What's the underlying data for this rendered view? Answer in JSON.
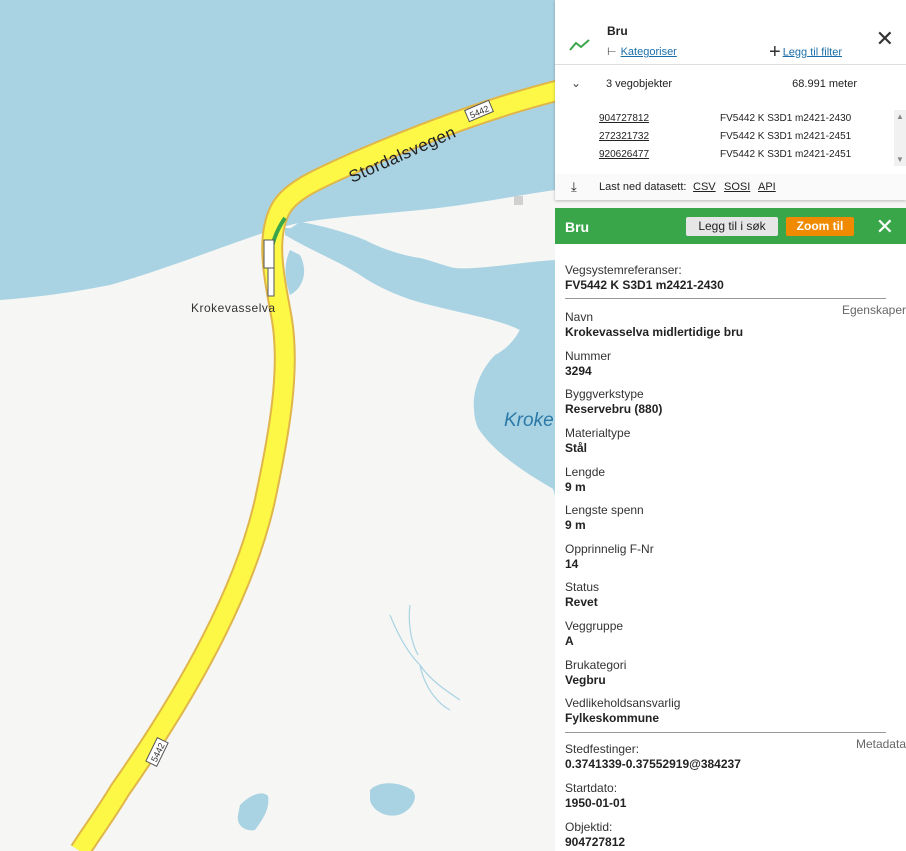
{
  "map": {
    "road_name": "Stordalsvegen",
    "road_number": "5442",
    "place_label": "Krokevasselva",
    "lake_label": "Kroke"
  },
  "search_panel": {
    "title": "Bru",
    "categorize_link": "Kategoriser",
    "add_filter_link": "Legg til filter",
    "object_count": "3 vegobjekter",
    "total_length": "68.991 meter",
    "objects": [
      {
        "id": "904727812",
        "ref": "FV5442 K S3D1 m2421-2430"
      },
      {
        "id": "272321732",
        "ref": "FV5442 K S3D1 m2421-2451"
      },
      {
        "id": "920626477",
        "ref": "FV5442 K S3D1 m2421-2451"
      }
    ],
    "download_label": "Last ned datasett:",
    "formats": [
      "CSV",
      "SOSI",
      "API"
    ]
  },
  "detail_panel": {
    "title": "Bru",
    "add_to_search_label": "Legg til i søk",
    "zoom_label": "Zoom til",
    "vegsystem_key": "Vegsystemreferanser:",
    "vegsystem_value": "FV5442 K S3D1 m2421-2430",
    "section_properties": "Egenskaper",
    "properties": [
      {
        "key": "Navn",
        "value": "Krokevasselva midlertidige bru"
      },
      {
        "key": "Nummer",
        "value": "3294"
      },
      {
        "key": "Byggverkstype",
        "value": "Reservebru (880)"
      },
      {
        "key": "Materialtype",
        "value": "Stål"
      },
      {
        "key": "Lengde",
        "value": "9 m"
      },
      {
        "key": "Lengste spenn",
        "value": "9 m"
      },
      {
        "key": "Opprinnelig F-Nr",
        "value": "14"
      },
      {
        "key": "Status",
        "value": "Revet"
      },
      {
        "key": "Veggruppe",
        "value": "A"
      },
      {
        "key": "Brukategori",
        "value": "Vegbru"
      },
      {
        "key": "Vedlikeholdsansvarlig",
        "value": "Fylkeskommune"
      }
    ],
    "section_metadata": "Metadata",
    "metadata": [
      {
        "key": "Stedfestinger:",
        "value": "0.3741339-0.37552919@384237"
      },
      {
        "key": "Startdato:",
        "value": "1950-01-01"
      },
      {
        "key": "Objektid:",
        "value": "904727812"
      }
    ]
  },
  "colors": {
    "water": "#a9d3e3",
    "land": "#f6f6f4",
    "road_fill": "#fdf845",
    "road_edge": "#e0b64a",
    "header_green": "#3aa64a",
    "zoom_orange": "#f08a00",
    "link_blue": "#1b6fa8"
  }
}
